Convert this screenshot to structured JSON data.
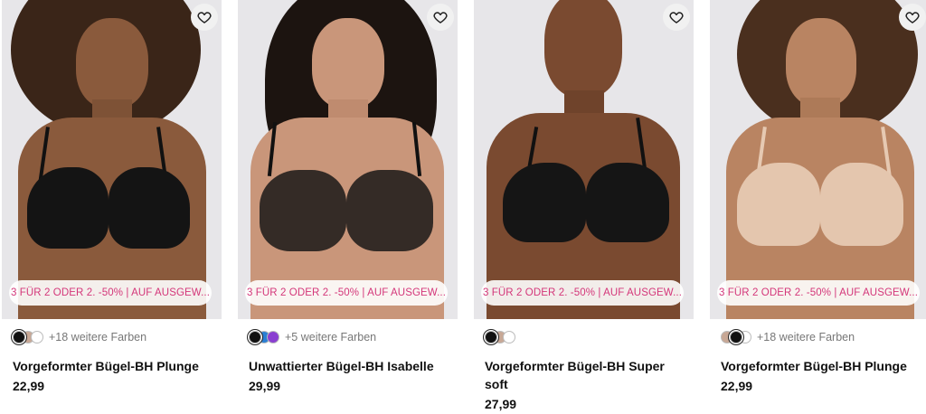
{
  "products": [
    {
      "promo": "3 FÜR 2 ODER 2. -50% | AUF AUSGEW...",
      "swatches": [
        "#111111",
        "#c8a896",
        "#ffffff"
      ],
      "more_colors": "+18 weitere Farben",
      "title": "Vorgeformter Bügel-BH Plunge",
      "price": "22,99"
    },
    {
      "promo": "3 FÜR 2 ODER 2. -50% | AUF AUSGEW...",
      "swatches": [
        "#111111",
        "#2a7fd4",
        "#8a3fd1"
      ],
      "more_colors": "+5 weitere Farben",
      "title": "Unwattierter Bügel-BH Isabelle",
      "price": "29,99"
    },
    {
      "promo": "3 FÜR 2 ODER 2. -50% | AUF AUSGEW...",
      "swatches": [
        "#111111",
        "#c8a896",
        "#ffffff"
      ],
      "more_colors": "",
      "title": "Vorgeformter Bügel-BH Super soft",
      "price": "27,99"
    },
    {
      "promo": "3 FÜR 2 ODER 2. -50% | AUF AUSGEW...",
      "swatches": [
        "#c8a896",
        "#111111",
        "#ffffff"
      ],
      "more_colors": "+18 weitere Farben",
      "title": "Vorgeformter Bügel-BH Plunge",
      "price": "22,99"
    }
  ],
  "icons": {
    "wishlist": "heart-icon"
  }
}
